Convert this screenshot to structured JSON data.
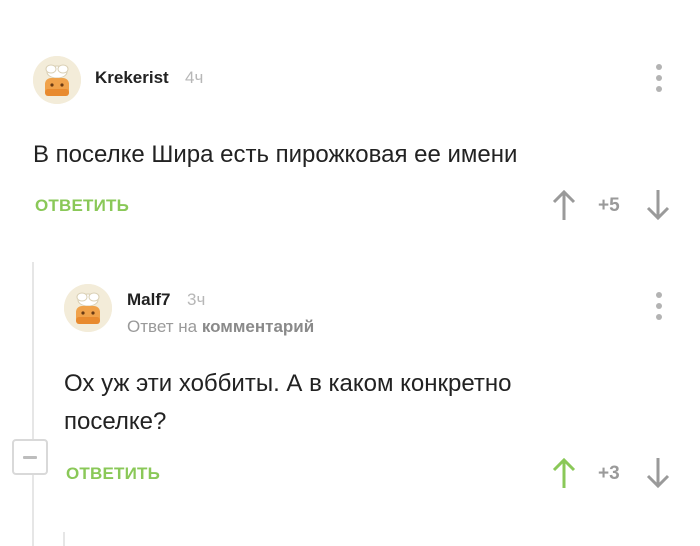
{
  "comments": [
    {
      "author": "Krekerist",
      "time": "4ч",
      "text": "В поселке Шира есть пирожковая ее имени",
      "reply_label": "ОТВЕТИТЬ",
      "rating": "+5",
      "upvoted": false
    },
    {
      "author": "Malf7",
      "time": "3ч",
      "reply_prefix": "Ответ на",
      "reply_link": "комментарий",
      "text_line1": "Ох уж эти хоббиты. А в каком конкретно",
      "text_line2": "поселке?",
      "reply_label": "ОТВЕТИТЬ",
      "rating": "+3",
      "upvoted": true
    }
  ],
  "colors": {
    "accent_green": "#8ac858",
    "muted_gray": "#9a9a9a",
    "thread_line": "#e6e6e6"
  },
  "icons": [
    "avatar-cake-icon",
    "more-vertical-icon",
    "arrow-up-icon",
    "arrow-down-icon",
    "collapse-minus-icon"
  ]
}
